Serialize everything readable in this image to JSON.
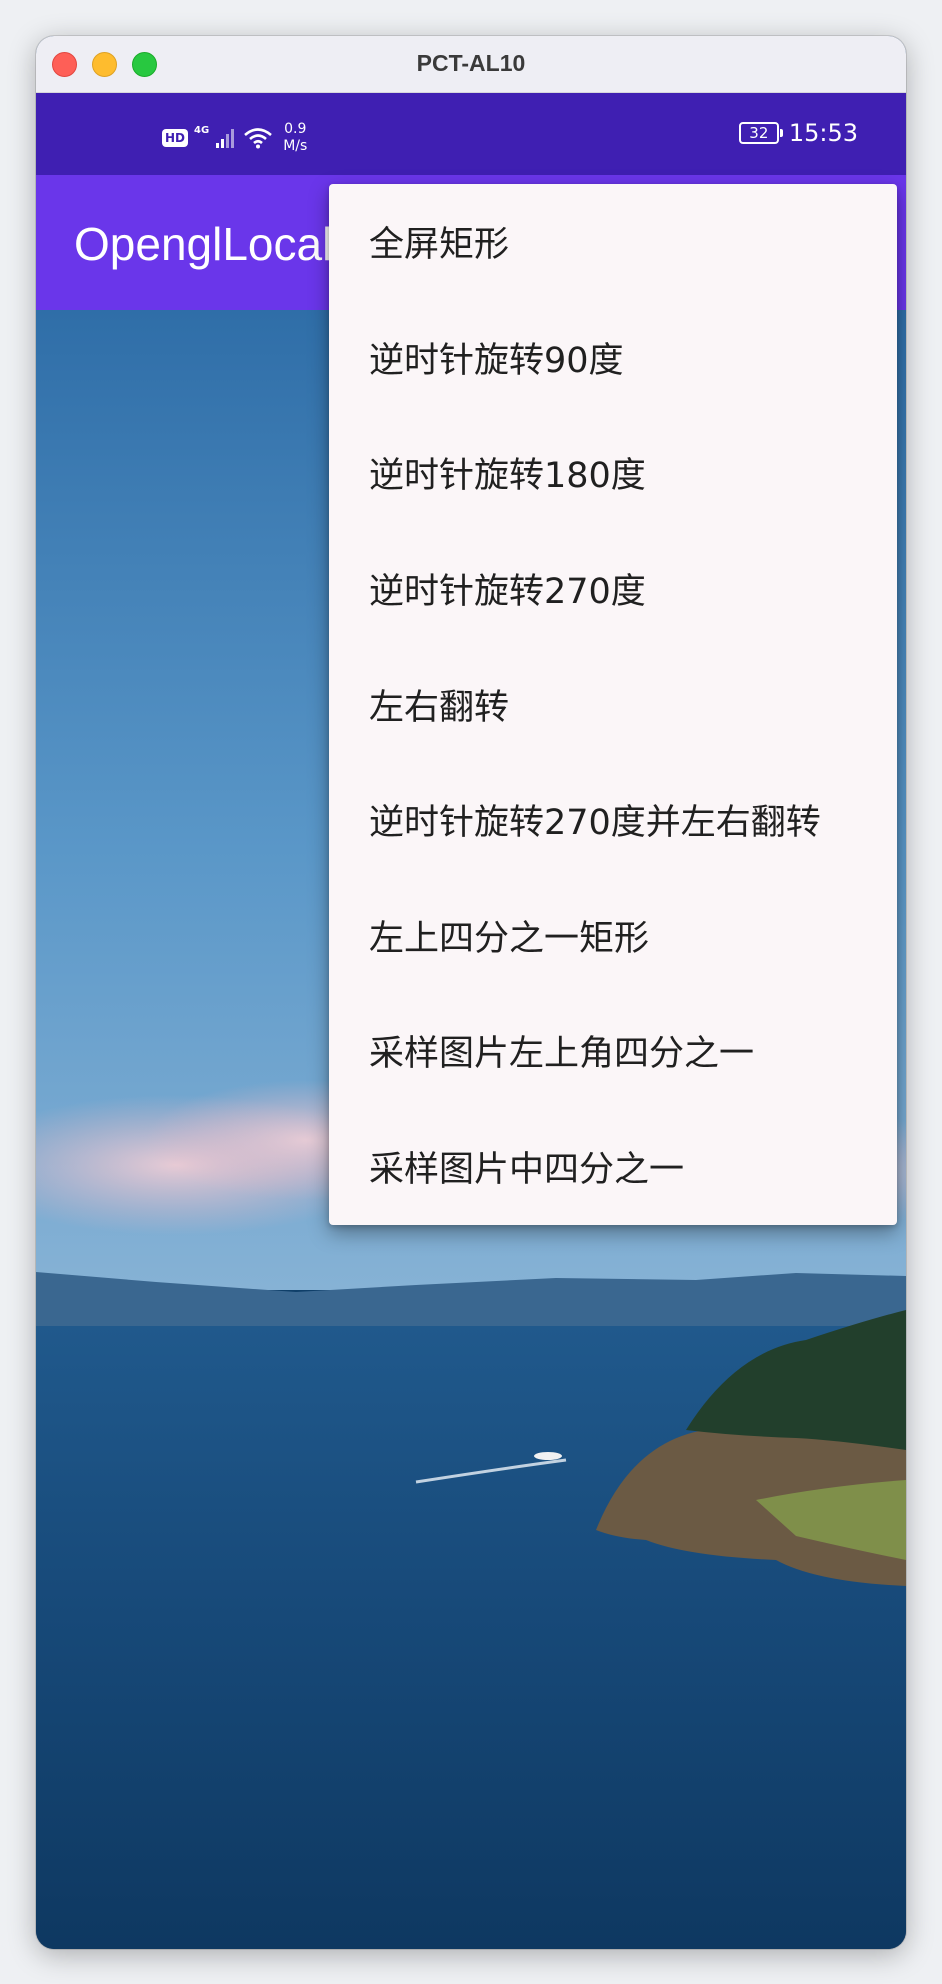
{
  "window": {
    "title": "PCT-AL10"
  },
  "status_bar": {
    "hd_label": "HD",
    "network_label": "4G",
    "speed_value": "0.9",
    "speed_unit": "M/s",
    "battery": "32",
    "time": "15:53"
  },
  "app_bar": {
    "title": "OpenglLocalActivity"
  },
  "menu": {
    "items": [
      "全屏矩形",
      "逆时针旋转90度",
      "逆时针旋转180度",
      "逆时针旋转270度",
      "左右翻转",
      "逆时针旋转270度并左右翻转",
      "左上四分之一矩形",
      "采样图片左上角四分之一",
      "采样图片中四分之一"
    ]
  },
  "colors": {
    "status_bar": "#3f1fb2",
    "app_bar": "#6a36ea",
    "menu_background": "#fbf6f8"
  },
  "icons": [
    "hd-icon",
    "signal-icon",
    "wifi-icon",
    "battery-icon"
  ]
}
